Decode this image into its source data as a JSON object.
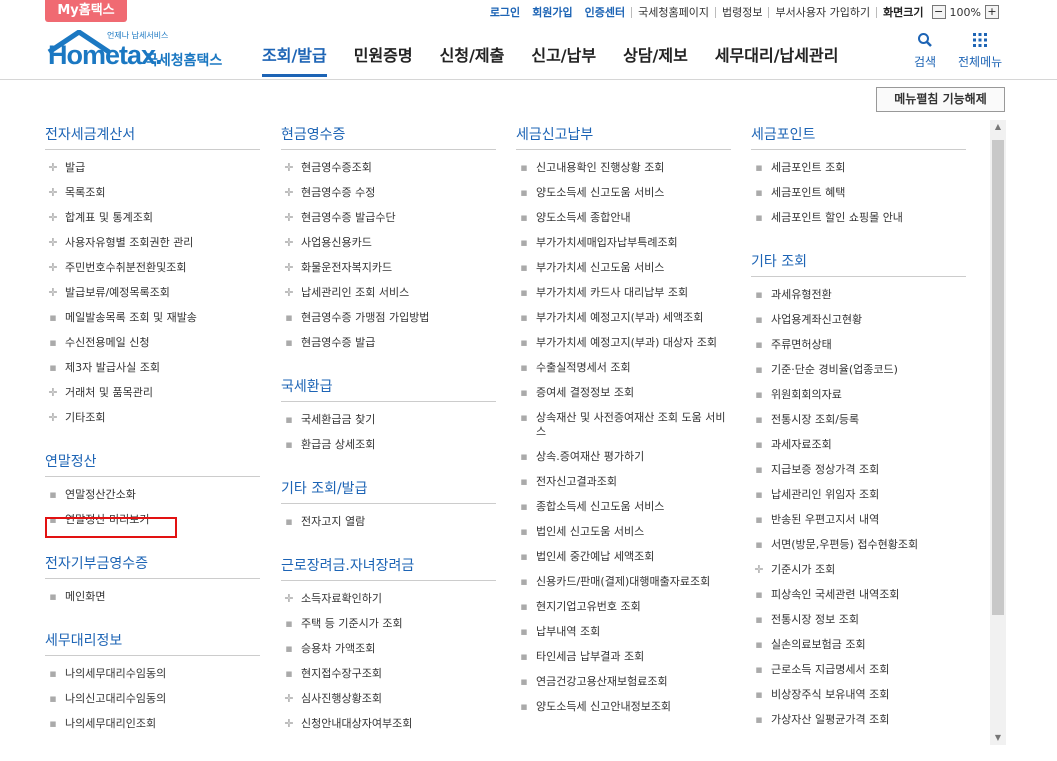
{
  "topbar": {
    "my_tab": "My홈택스",
    "links": [
      "로그인",
      "회원가입",
      "인증센터",
      "국세청홈페이지",
      "법령정보",
      "부서사용자 가입하기"
    ],
    "screen_size_label": "화면크기",
    "zoom_minus": "−",
    "zoom_value": "100%",
    "zoom_plus": "+"
  },
  "header": {
    "logo_sub": "언제나 납세서비스",
    "logo_main": "Hometax.",
    "logo_kr": "국세청홈택스",
    "nav": [
      "조회/발급",
      "민원증명",
      "신청/제출",
      "신고/납부",
      "상담/제보",
      "세무대리/납세관리"
    ],
    "search_label": "검색",
    "allmenu_label": "전체메뉴"
  },
  "menu_toggle_button": "메뉴펼침 기능해제",
  "columns": [
    {
      "sections": [
        {
          "title": "전자세금계산서",
          "items": [
            {
              "t": "발급",
              "b": "plus"
            },
            {
              "t": "목록조회",
              "b": "plus"
            },
            {
              "t": "합계표 및 통계조회",
              "b": "plus"
            },
            {
              "t": "사용자유형별 조회권한 관리",
              "b": "plus"
            },
            {
              "t": "주민번호수취분전환및조회",
              "b": "plus"
            },
            {
              "t": "발급보류/예정목록조회",
              "b": "plus"
            },
            {
              "t": "메일발송목록 조회 및 재발송",
              "b": "dot"
            },
            {
              "t": "수신전용메일 신청",
              "b": "dot"
            },
            {
              "t": "제3자 발급사실 조회",
              "b": "dot"
            },
            {
              "t": "거래처 및 품목관리",
              "b": "plus"
            },
            {
              "t": "기타조회",
              "b": "plus"
            }
          ]
        },
        {
          "title": "연말정산",
          "items": [
            {
              "t": "연말정산간소화",
              "b": "dot"
            },
            {
              "t": "연말정산 미리보기",
              "b": "dot"
            }
          ]
        },
        {
          "title": "전자기부금영수증",
          "items": [
            {
              "t": "메인화면",
              "b": "dot"
            }
          ]
        },
        {
          "title": "세무대리정보",
          "items": [
            {
              "t": "나의세무대리수임동의",
              "b": "dot"
            },
            {
              "t": "나의신고대리수임동의",
              "b": "dot"
            },
            {
              "t": "나의세무대리인조회",
              "b": "dot"
            }
          ]
        }
      ]
    },
    {
      "sections": [
        {
          "title": "현금영수증",
          "items": [
            {
              "t": "현금영수증조회",
              "b": "plus"
            },
            {
              "t": "현금영수증 수정",
              "b": "plus"
            },
            {
              "t": "현금영수증 발급수단",
              "b": "plus"
            },
            {
              "t": "사업용신용카드",
              "b": "plus"
            },
            {
              "t": "화물운전자복지카드",
              "b": "plus"
            },
            {
              "t": "납세관리인 조회 서비스",
              "b": "plus"
            },
            {
              "t": "현금영수증 가맹점 가입방법",
              "b": "dot"
            },
            {
              "t": "현금영수증 발급",
              "b": "dot"
            }
          ]
        },
        {
          "title": "국세환급",
          "items": [
            {
              "t": "국세환급금 찾기",
              "b": "dot"
            },
            {
              "t": "환급금 상세조회",
              "b": "dot"
            }
          ]
        },
        {
          "title": "기타 조회/발급",
          "items": [
            {
              "t": "전자고지 열람",
              "b": "dot"
            }
          ]
        },
        {
          "title": "근로장려금.자녀장려금",
          "items": [
            {
              "t": "소득자료확인하기",
              "b": "plus"
            },
            {
              "t": "주택 등 기준시가 조회",
              "b": "dot"
            },
            {
              "t": "승용차 가액조회",
              "b": "dot"
            },
            {
              "t": "현지접수장구조회",
              "b": "dot"
            },
            {
              "t": "심사진행상황조회",
              "b": "plus"
            },
            {
              "t": "신청안내대상자여부조회",
              "b": "plus"
            }
          ]
        }
      ]
    },
    {
      "sections": [
        {
          "title": "세금신고납부",
          "items": [
            {
              "t": "신고내용확인 진행상황 조회",
              "b": "dot"
            },
            {
              "t": "양도소득세 신고도움 서비스",
              "b": "dot"
            },
            {
              "t": "양도소득세 종합안내",
              "b": "dot"
            },
            {
              "t": "부가가치세매입자납부특례조회",
              "b": "dot"
            },
            {
              "t": "부가가치세 신고도움 서비스",
              "b": "dot"
            },
            {
              "t": "부가가치세 카드사 대리납부 조회",
              "b": "dot"
            },
            {
              "t": "부가가치세 예정고지(부과) 세액조회",
              "b": "dot"
            },
            {
              "t": "부가가치세 예정고지(부과) 대상자 조회",
              "b": "dot"
            },
            {
              "t": "수출실적명세서 조회",
              "b": "dot"
            },
            {
              "t": "증여세 결정정보 조회",
              "b": "dot"
            },
            {
              "t": "상속재산 및 사전증여재산 조회 도움 서비스",
              "b": "dot"
            },
            {
              "t": "상속.증여재산 평가하기",
              "b": "dot"
            },
            {
              "t": "전자신고결과조회",
              "b": "dot"
            },
            {
              "t": "종합소득세 신고도움 서비스",
              "b": "dot"
            },
            {
              "t": "법인세 신고도움 서비스",
              "b": "dot"
            },
            {
              "t": "법인세 중간예납 세액조회",
              "b": "dot"
            },
            {
              "t": "신용카드/판매(결제)대행매출자료조회",
              "b": "dot"
            },
            {
              "t": "현지기업고유번호 조회",
              "b": "dot"
            },
            {
              "t": "납부내역 조회",
              "b": "dot"
            },
            {
              "t": "타인세금 납부결과 조회",
              "b": "dot"
            },
            {
              "t": "연금건강고용산재보험료조회",
              "b": "dot"
            },
            {
              "t": "양도소득세 신고안내정보조회",
              "b": "dot"
            }
          ]
        }
      ]
    },
    {
      "sections": [
        {
          "title": "세금포인트",
          "items": [
            {
              "t": "세금포인트 조회",
              "b": "dot"
            },
            {
              "t": "세금포인트 혜택",
              "b": "dot"
            },
            {
              "t": "세금포인트 할인 쇼핑몰 안내",
              "b": "dot"
            }
          ]
        },
        {
          "title": "기타 조회",
          "items": [
            {
              "t": "과세유형전환",
              "b": "dot"
            },
            {
              "t": "사업용계좌신고현황",
              "b": "dot"
            },
            {
              "t": "주류면허상태",
              "b": "dot"
            },
            {
              "t": "기준·단순 경비율(업종코드)",
              "b": "dot"
            },
            {
              "t": "위원회회의자료",
              "b": "dot"
            },
            {
              "t": "전통시장 조회/등록",
              "b": "dot"
            },
            {
              "t": "과세자료조회",
              "b": "dot"
            },
            {
              "t": "지급보증 정상가격 조회",
              "b": "dot"
            },
            {
              "t": "납세관리인 위임자 조회",
              "b": "dot"
            },
            {
              "t": "반송된 우편고지서 내역",
              "b": "dot"
            },
            {
              "t": "서면(방문,우편등) 접수현황조회",
              "b": "dot"
            },
            {
              "t": "기준시가 조회",
              "b": "plus"
            },
            {
              "t": "피상속인 국세관련 내역조회",
              "b": "dot"
            },
            {
              "t": "전통시장 정보 조회",
              "b": "dot"
            },
            {
              "t": "실손의료보험금 조회",
              "b": "dot"
            },
            {
              "t": "근로소득 지급명세서 조회",
              "b": "dot"
            },
            {
              "t": "비상장주식 보유내역 조회",
              "b": "dot"
            },
            {
              "t": "가상자산 일평균가격 조회",
              "b": "dot"
            }
          ]
        }
      ]
    }
  ]
}
